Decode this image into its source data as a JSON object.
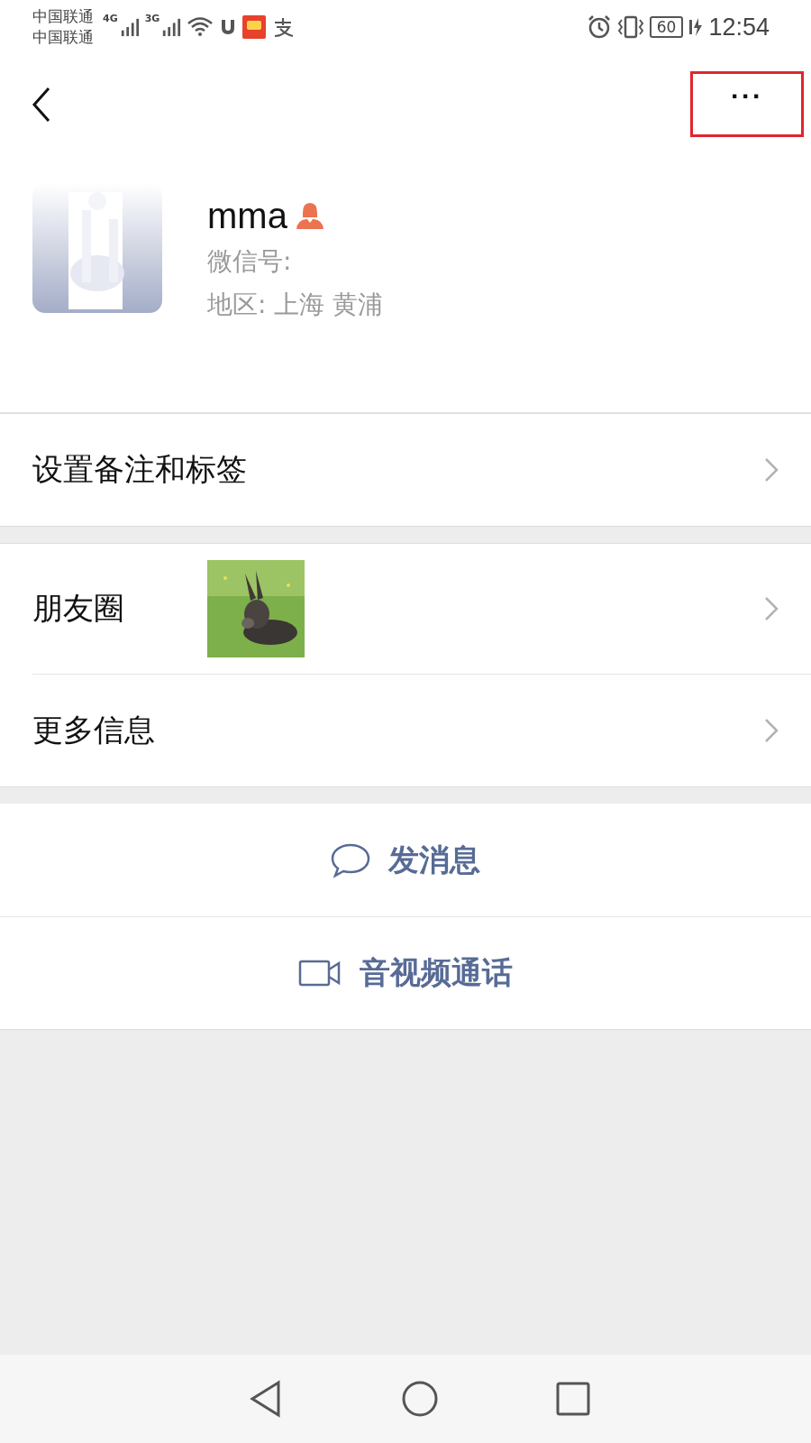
{
  "status_bar": {
    "carriers": [
      "中国联通",
      "中国联通"
    ],
    "networks": [
      "4G",
      "3G"
    ],
    "battery": "60",
    "time": "12:54"
  },
  "nav": {
    "more": "···",
    "highlighted": true
  },
  "profile": {
    "name": "mma",
    "wechat_id": "微信号:",
    "region": "地区: 上海  黄浦"
  },
  "sections": [
    [
      {
        "label": "设置备注和标签",
        "kind": "plain"
      }
    ],
    [
      {
        "label": "朋友圈",
        "kind": "moments"
      },
      {
        "label": "更多信息",
        "kind": "plain"
      }
    ]
  ],
  "actions": [
    {
      "label": "发消息",
      "kind": "message"
    },
    {
      "label": "音视频通话",
      "kind": "video"
    }
  ]
}
